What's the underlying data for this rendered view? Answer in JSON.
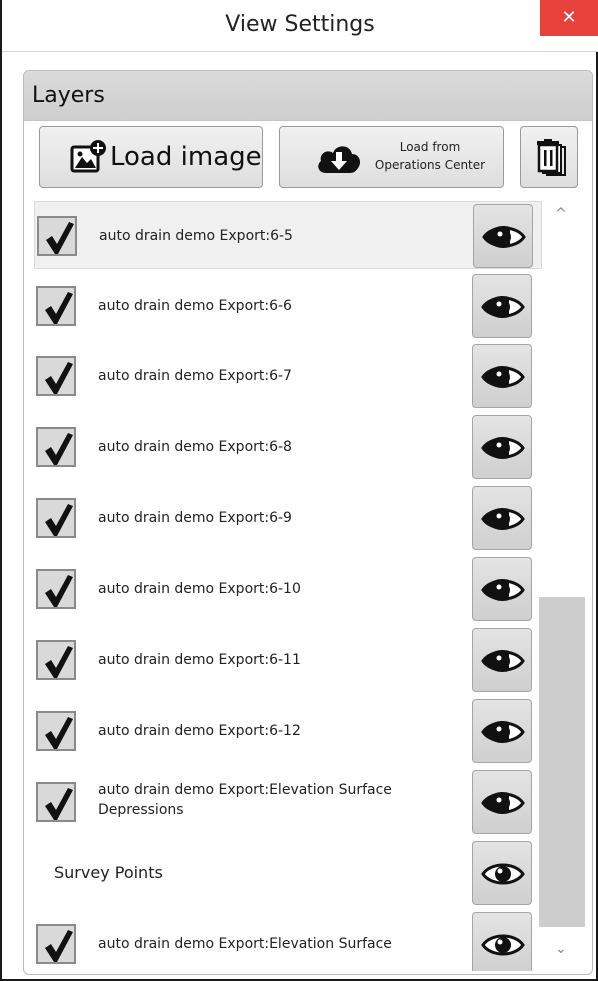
{
  "window": {
    "title": "View Settings",
    "close_label": "✕"
  },
  "layers": {
    "title": "Layers",
    "toolbar": {
      "load_image_label": "Load image",
      "load_ops_line1": "Load from",
      "load_ops_line2": "Operations Center"
    },
    "items": [
      {
        "label": "auto drain demo Export:6-5",
        "checked": true,
        "selected": true,
        "visible": true
      },
      {
        "label": "auto drain demo Export:6-6",
        "checked": true,
        "selected": false,
        "visible": true
      },
      {
        "label": "auto drain demo Export:6-7",
        "checked": true,
        "selected": false,
        "visible": true
      },
      {
        "label": "auto drain demo Export:6-8",
        "checked": true,
        "selected": false,
        "visible": true
      },
      {
        "label": "auto drain demo Export:6-9",
        "checked": true,
        "selected": false,
        "visible": true
      },
      {
        "label": "auto drain demo Export:6-10",
        "checked": true,
        "selected": false,
        "visible": true
      },
      {
        "label": "auto drain demo Export:6-11",
        "checked": true,
        "selected": false,
        "visible": true
      },
      {
        "label": "auto drain demo Export:6-12",
        "checked": true,
        "selected": false,
        "visible": true
      },
      {
        "label": "auto drain demo Export:Elevation Surface Depressions",
        "checked": true,
        "selected": false,
        "visible": true
      },
      {
        "label": "Survey Points",
        "checked": null,
        "selected": false,
        "visible": true
      },
      {
        "label": "auto drain demo Export:Elevation Surface",
        "checked": true,
        "selected": false,
        "visible": true
      }
    ]
  },
  "scrollbar": {
    "up_glyph": "^",
    "down_glyph": "⌄"
  },
  "colors": {
    "close_button": "#e8413c",
    "panel_header": "#d4d4d4",
    "checkbox_bg": "#d9d9d9",
    "scroll_thumb": "#cdcdcd"
  }
}
